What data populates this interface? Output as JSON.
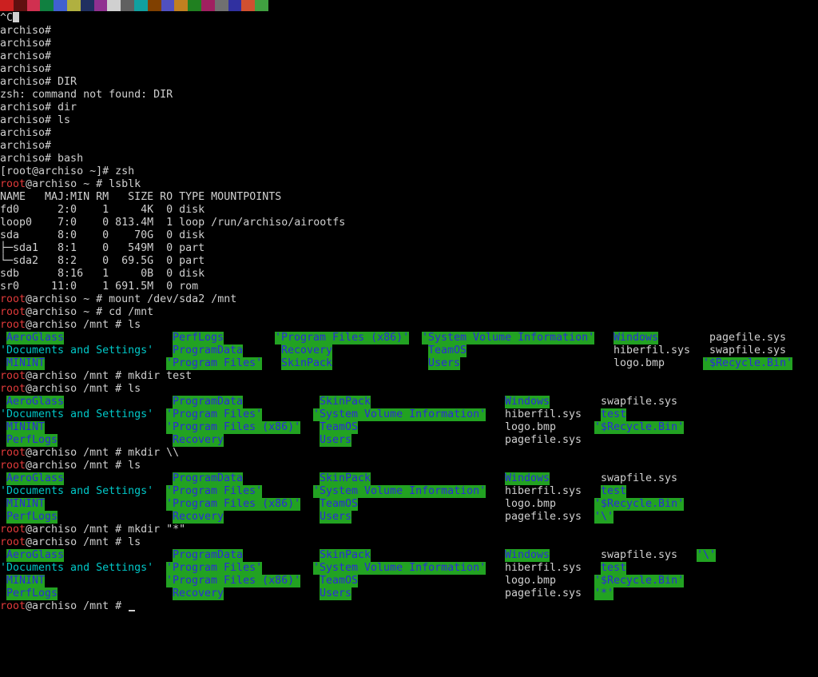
{
  "colors": {
    "background": "#000000",
    "text": "#d0d0d0",
    "prompt_user": "#e03a3a",
    "dir_fg": "#2b2bd8",
    "dir_bg": "#22a222",
    "link_fg": "#00c8c8",
    "strip": [
      "#cc2020",
      "#601010",
      "#d03050",
      "#108040",
      "#4060d0",
      "#b0b040",
      "#203060",
      "#903090",
      "#d0d0d0",
      "#606060",
      "#10a0a0",
      "#804000",
      "#5050c0",
      "#c08020",
      "#208020",
      "#a02060",
      "#707070",
      "#3030a0",
      "#d05030",
      "#40a040"
    ]
  },
  "lines": {
    "l00": "^C",
    "l01": "archiso#",
    "l02": "archiso#",
    "l03": "archiso#",
    "l04": "archiso#",
    "l05": "archiso# DIR",
    "l06": "zsh: command not found: DIR",
    "l07": "archiso# dir",
    "l08": "archiso# ls",
    "l09": "archiso#",
    "l10": "archiso#",
    "l11": "archiso# bash",
    "l12": "[root@archiso ~]# zsh",
    "l13": "~ # lsblk",
    "l14": "NAME   MAJ:MIN RM   SIZE RO TYPE MOUNTPOINTS",
    "l15": "fd0      2:0    1     4K  0 disk",
    "l16": "loop0    7:0    0 813.4M  1 loop /run/archiso/airootfs",
    "l17": "sda      8:0    0    70G  0 disk",
    "l18": "├─sda1   8:1    0   549M  0 part",
    "l19": "└─sda2   8:2    0  69.5G  0 part",
    "l20": "sdb      8:16   1     0B  0 disk",
    "l21": "sr0     11:0    1 691.5M  0 rom",
    "l22": "~ # mount /dev/sda2 /mnt",
    "l23": "~ # cd /mnt",
    "l24": "/mnt # ls",
    "l28": "/mnt # mkdir test",
    "l29": "/mnt # ls",
    "l34": "/mnt # mkdir \\\\",
    "l35": "/mnt # ls",
    "l40": "/mnt # mkdir \"*\"",
    "l41": "/mnt # ls",
    "l46": "/mnt # "
  },
  "prompt": {
    "user": "root",
    "host": "@archiso "
  },
  "ls1": {
    "r1": [
      "AeroGlass",
      "PerfLogs",
      "'Program Files (x86)'",
      "'System Volume Information'",
      "Windows",
      "pagefile.sys"
    ],
    "r2": [
      "'Documents and Settings'",
      "ProgramData",
      "Recovery",
      "TeamOS",
      "hiberfil.sys",
      "swapfile.sys"
    ],
    "r3": [
      "MININT",
      "'Program Files'",
      "SkinPack",
      "Users",
      "logo.bmp",
      "'$Recycle.Bin'"
    ]
  },
  "ls2": {
    "r1": [
      "AeroGlass",
      "ProgramData",
      "SkinPack",
      "Windows",
      "swapfile.sys"
    ],
    "r2": [
      "'Documents and Settings'",
      "'Program Files'",
      "'System Volume Information'",
      "hiberfil.sys",
      "test"
    ],
    "r3": [
      "MININT",
      "'Program Files (x86)'",
      "TeamOS",
      "logo.bmp",
      "'$Recycle.Bin'"
    ],
    "r4": [
      "PerfLogs",
      "Recovery",
      "Users",
      "pagefile.sys"
    ]
  },
  "ls3": {
    "r1": [
      "AeroGlass",
      "ProgramData",
      "SkinPack",
      "Windows",
      "swapfile.sys"
    ],
    "r2": [
      "'Documents and Settings'",
      "'Program Files'",
      "'System Volume Information'",
      "hiberfil.sys",
      "test"
    ],
    "r3": [
      "MININT",
      "'Program Files (x86)'",
      "TeamOS",
      "logo.bmp",
      "'$Recycle.Bin'"
    ],
    "r4": [
      "PerfLogs",
      "Recovery",
      "Users",
      "pagefile.sys",
      "'\\'"
    ]
  },
  "ls4": {
    "r1": [
      "AeroGlass",
      "ProgramData",
      "SkinPack",
      "Windows",
      "swapfile.sys",
      "'\\'"
    ],
    "r2": [
      "'Documents and Settings'",
      "'Program Files'",
      "'System Volume Information'",
      "hiberfil.sys",
      "test"
    ],
    "r3": [
      "MININT",
      "'Program Files (x86)'",
      "TeamOS",
      "logo.bmp",
      "'$Recycle.Bin'"
    ],
    "r4": [
      "PerfLogs",
      "Recovery",
      "Users",
      "pagefile.sys",
      "'*'"
    ]
  }
}
